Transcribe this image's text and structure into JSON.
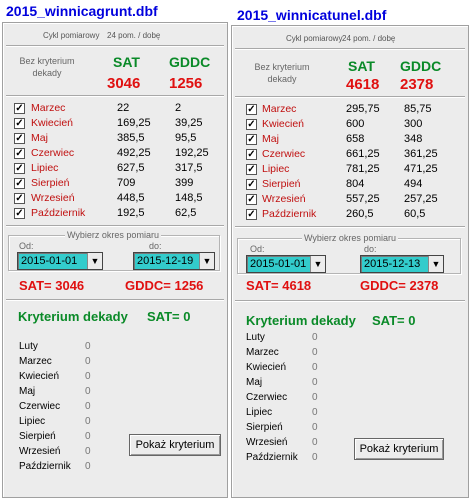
{
  "panels": [
    {
      "title": "2015_winnicagrunt.dbf",
      "cycle_label": "Cykl pomiarowy",
      "cycle_value": "24 pom. / dobę",
      "criterion_label": "Bez kryterium dekady",
      "col_sat": "SAT",
      "col_gddc": "GDDC",
      "total_sat": "3046",
      "total_gddc": "1256",
      "rows": [
        {
          "checked": "✓",
          "month": "Marzec",
          "sat": "22",
          "gddc": "2"
        },
        {
          "checked": "✓",
          "month": "Kwiecień",
          "sat": "169,25",
          "gddc": "39,25"
        },
        {
          "checked": "✓",
          "month": "Maj",
          "sat": "385,5",
          "gddc": "95,5"
        },
        {
          "checked": "✓",
          "month": "Czerwiec",
          "sat": "492,25",
          "gddc": "192,25"
        },
        {
          "checked": "✓",
          "month": "Lipiec",
          "sat": "627,5",
          "gddc": "317,5"
        },
        {
          "checked": "✓",
          "month": "Sierpień",
          "sat": "709",
          "gddc": "399"
        },
        {
          "checked": "✓",
          "month": "Wrzesień",
          "sat": "448,5",
          "gddc": "148,5"
        },
        {
          "checked": "✓",
          "month": "Październik",
          "sat": "192,5",
          "gddc": "62,5"
        }
      ],
      "period_label": "Wybierz okres pomiaru",
      "from_label": "Od:",
      "to_label": "do:",
      "from_value": "2015-01-01",
      "to_value": "2015-12-19",
      "arrow": "▼",
      "sat_summary": "SAT= 3046",
      "gddc_summary": "GDDC= 1256",
      "decade_title": "Kryterium  dekady",
      "decade_sat": "SAT= 0",
      "decade_rows": [
        {
          "month": "Luty",
          "value": "0"
        },
        {
          "month": "Marzec",
          "value": "0"
        },
        {
          "month": "Kwiecień",
          "value": "0"
        },
        {
          "month": "Maj",
          "value": "0"
        },
        {
          "month": "Czerwiec",
          "value": "0"
        },
        {
          "month": "Lipiec",
          "value": "0"
        },
        {
          "month": "Sierpień",
          "value": "0"
        },
        {
          "month": "Wrzesień",
          "value": "0"
        },
        {
          "month": "Październik",
          "value": "0"
        }
      ],
      "button_label": "Pokaż kryterium"
    },
    {
      "title": "2015_winnicatunel.dbf",
      "cycle_label": "Cykl pomiarowy",
      "cycle_value": "24 pom. / dobę",
      "criterion_label": "Bez kryterium dekady",
      "col_sat": "SAT",
      "col_gddc": "GDDC",
      "total_sat": "4618",
      "total_gddc": "2378",
      "rows": [
        {
          "checked": "✓",
          "month": "Marzec",
          "sat": "295,75",
          "gddc": "85,75"
        },
        {
          "checked": "✓",
          "month": "Kwiecień",
          "sat": "600",
          "gddc": "300"
        },
        {
          "checked": "✓",
          "month": "Maj",
          "sat": "658",
          "gddc": "348"
        },
        {
          "checked": "✓",
          "month": "Czerwiec",
          "sat": "661,25",
          "gddc": "361,25"
        },
        {
          "checked": "✓",
          "month": "Lipiec",
          "sat": "781,25",
          "gddc": "471,25"
        },
        {
          "checked": "✓",
          "month": "Sierpień",
          "sat": "804",
          "gddc": "494"
        },
        {
          "checked": "✓",
          "month": "Wrzesień",
          "sat": "557,25",
          "gddc": "257,25"
        },
        {
          "checked": "✓",
          "month": "Październik",
          "sat": "260,5",
          "gddc": "60,5"
        }
      ],
      "period_label": "Wybierz okres pomiaru",
      "from_label": "Od:",
      "to_label": "do:",
      "from_value": "2015-01-01",
      "to_value": "2015-12-13",
      "arrow": "▼",
      "sat_summary": "SAT= 4618",
      "gddc_summary": "GDDC= 2378",
      "decade_title": "Kryterium  dekady",
      "decade_sat": "SAT= 0",
      "decade_rows": [
        {
          "month": "Luty",
          "value": "0"
        },
        {
          "month": "Marzec",
          "value": "0"
        },
        {
          "month": "Kwiecień",
          "value": "0"
        },
        {
          "month": "Maj",
          "value": "0"
        },
        {
          "month": "Czerwiec",
          "value": "0"
        },
        {
          "month": "Lipiec",
          "value": "0"
        },
        {
          "month": "Sierpień",
          "value": "0"
        },
        {
          "month": "Wrzesień",
          "value": "0"
        },
        {
          "month": "Październik",
          "value": "0"
        }
      ],
      "button_label": "Pokaż kryterium"
    }
  ]
}
